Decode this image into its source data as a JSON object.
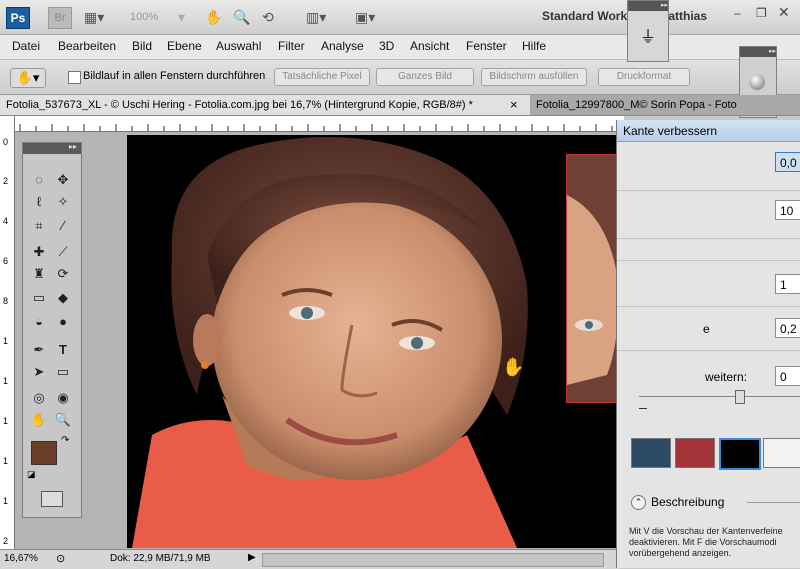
{
  "appbar": {
    "ps_logo": "Ps",
    "br_logo": "Br",
    "zoom": "100%",
    "workspace": "Standard Work",
    "workspace_suffix": "latthias",
    "icons": [
      "film-icon",
      "hand-icon",
      "zoom-icon",
      "rotate-icon",
      "arrange-icon",
      "screen-mode-icon"
    ]
  },
  "menu": [
    "Datei",
    "Bearbeiten",
    "Bild",
    "Ebene",
    "Auswahl",
    "Filter",
    "Analyse",
    "3D",
    "Ansicht",
    "Fenster",
    "Hilfe"
  ],
  "options": {
    "checkbox_label": "Bildlauf in allen Fenstern durchführen",
    "checked": false,
    "buttons": [
      "Tatsächliche Pixel",
      "Ganzes Bild",
      "Bildschirm ausfüllen",
      "Druckformat"
    ]
  },
  "tabs": [
    {
      "label": "Fotolia_537673_XL - © Uschi Hering - Fotolia.com.jpg bei 16,7% (Hintergrund Kopie, RGB/8#) *",
      "close": "×",
      "active": true
    },
    {
      "label": "Fotolia_12997800_M© Sorin Popa - Foto",
      "active": false
    }
  ],
  "ruler_vertical": [
    "0",
    "2",
    "4",
    "6",
    "8",
    "1",
    "1",
    "1",
    "1",
    "1",
    "2"
  ],
  "status": {
    "zoom": "16,67%",
    "doc": "Dok: 22,9 MB/71,9 MB"
  },
  "colors": {
    "foreground": "#6b3f2a",
    "background": "#ffffff",
    "accent": "#1a5f9e"
  },
  "dialog": {
    "title": "Kante verbessern",
    "values": [
      "0,0",
      "10",
      "1",
      "0,2",
      "0"
    ],
    "partial_labels": [
      "e",
      "weitern:"
    ],
    "description_label": "Beschreibung",
    "description_text": "Mit V die Vorschau der Kantenverfeine deaktivieren. Mit F die Vorschaumodi vorübergehend anzeigen."
  }
}
